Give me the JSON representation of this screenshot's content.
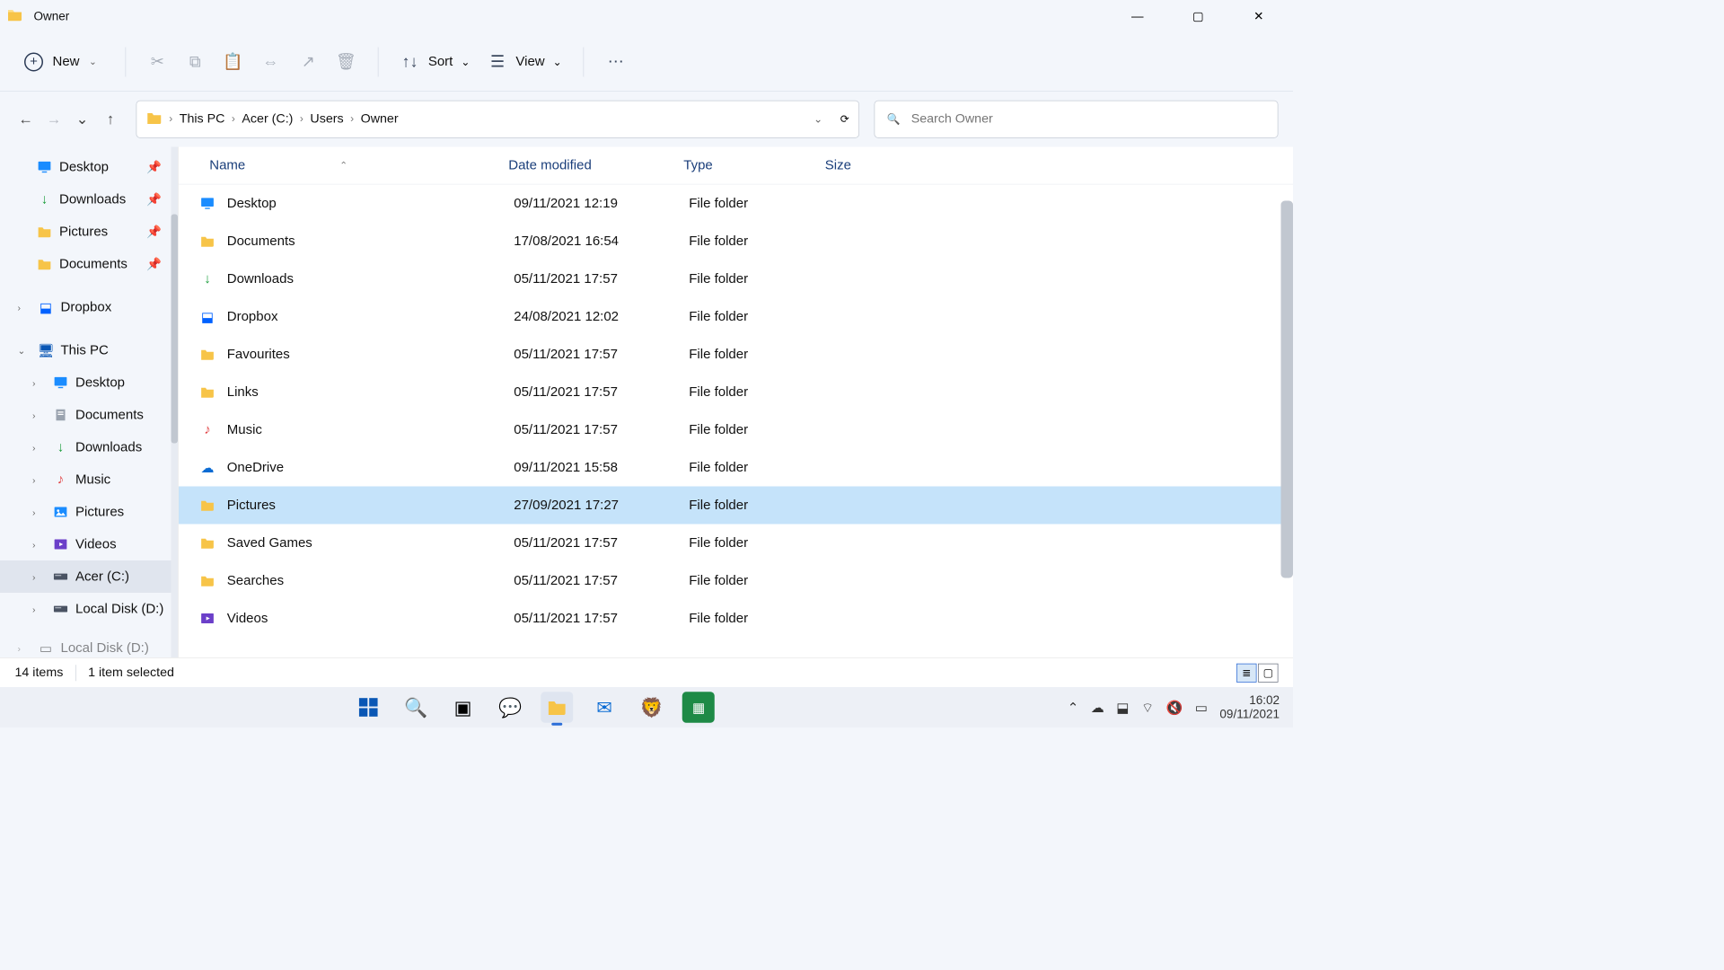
{
  "title": "Owner",
  "toolbar": {
    "new_label": "New",
    "sort_label": "Sort",
    "view_label": "View"
  },
  "breadcrumb": [
    "This PC",
    "Acer (C:)",
    "Users",
    "Owner"
  ],
  "search": {
    "placeholder": "Search Owner"
  },
  "sidebar": {
    "quick": [
      {
        "label": "Desktop",
        "icon": "desktop",
        "pinned": true
      },
      {
        "label": "Downloads",
        "icon": "download",
        "pinned": true
      },
      {
        "label": "Pictures",
        "icon": "folder",
        "pinned": true
      },
      {
        "label": "Documents",
        "icon": "folder",
        "pinned": true
      }
    ],
    "dropbox": {
      "label": "Dropbox"
    },
    "thispc": {
      "label": "This PC"
    },
    "pc_children": [
      {
        "label": "Desktop",
        "icon": "desktop"
      },
      {
        "label": "Documents",
        "icon": "doc"
      },
      {
        "label": "Downloads",
        "icon": "download"
      },
      {
        "label": "Music",
        "icon": "music"
      },
      {
        "label": "Pictures",
        "icon": "pictures"
      },
      {
        "label": "Videos",
        "icon": "videos"
      },
      {
        "label": "Acer (C:)",
        "icon": "drive",
        "selected": true
      },
      {
        "label": "Local Disk (D:)",
        "icon": "drive"
      }
    ],
    "truncated": {
      "label": "Local Disk (D:)"
    }
  },
  "columns": {
    "name": "Name",
    "date": "Date modified",
    "type": "Type",
    "size": "Size"
  },
  "rows": [
    {
      "name": "Desktop",
      "date": "09/11/2021 12:19",
      "type": "File folder",
      "size": "",
      "icon": "desktop"
    },
    {
      "name": "Documents",
      "date": "17/08/2021 16:54",
      "type": "File folder",
      "size": "",
      "icon": "folder"
    },
    {
      "name": "Downloads",
      "date": "05/11/2021 17:57",
      "type": "File folder",
      "size": "",
      "icon": "download"
    },
    {
      "name": "Dropbox",
      "date": "24/08/2021 12:02",
      "type": "File folder",
      "size": "",
      "icon": "dropbox"
    },
    {
      "name": "Favourites",
      "date": "05/11/2021 17:57",
      "type": "File folder",
      "size": "",
      "icon": "folder"
    },
    {
      "name": "Links",
      "date": "05/11/2021 17:57",
      "type": "File folder",
      "size": "",
      "icon": "folder"
    },
    {
      "name": "Music",
      "date": "05/11/2021 17:57",
      "type": "File folder",
      "size": "",
      "icon": "music"
    },
    {
      "name": "OneDrive",
      "date": "09/11/2021 15:58",
      "type": "File folder",
      "size": "",
      "icon": "onedrive"
    },
    {
      "name": "Pictures",
      "date": "27/09/2021 17:27",
      "type": "File folder",
      "size": "",
      "icon": "folder",
      "selected": true
    },
    {
      "name": "Saved Games",
      "date": "05/11/2021 17:57",
      "type": "File folder",
      "size": "",
      "icon": "folder"
    },
    {
      "name": "Searches",
      "date": "05/11/2021 17:57",
      "type": "File folder",
      "size": "",
      "icon": "folder"
    },
    {
      "name": "Videos",
      "date": "05/11/2021 17:57",
      "type": "File folder",
      "size": "",
      "icon": "videos"
    }
  ],
  "status": {
    "items": "14 items",
    "selected": "1 item selected"
  },
  "clock": {
    "time": "16:02",
    "date": "09/11/2021"
  }
}
